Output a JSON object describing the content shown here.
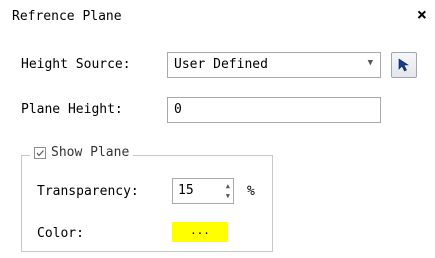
{
  "dialog": {
    "title": "Refrence Plane",
    "close_label": "×"
  },
  "height_source": {
    "label": "Height Source:",
    "value": "User Defined"
  },
  "plane_height": {
    "label": "Plane Height:",
    "value": "0"
  },
  "show_plane": {
    "label": "Show Plane",
    "checked": true,
    "transparency": {
      "label": "Transparency:",
      "value": "15",
      "unit": "%"
    },
    "color": {
      "label": "Color:",
      "button_label": "...",
      "value": "#ffff00"
    }
  },
  "icons": {
    "picker": "pointer-pick-icon",
    "dropdown": "chevron-down-icon",
    "spin_up": "spin-up-icon",
    "spin_down": "spin-down-icon",
    "check": "checkmark-icon"
  }
}
